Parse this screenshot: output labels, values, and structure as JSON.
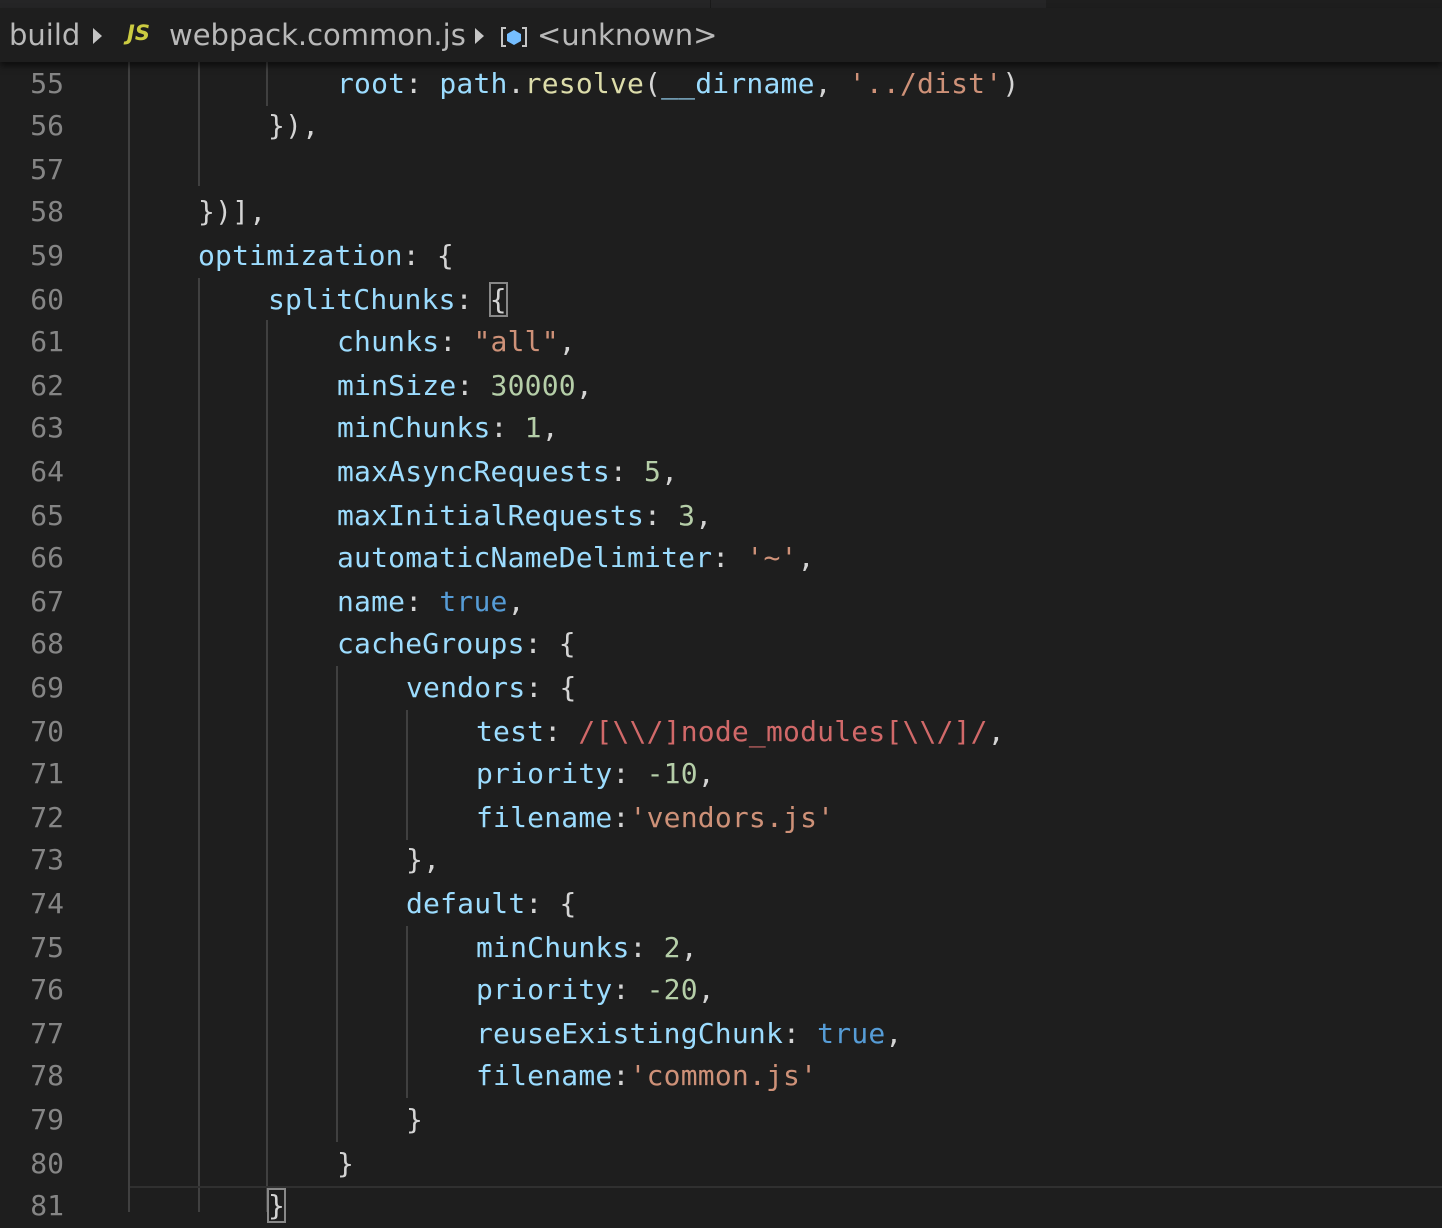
{
  "breadcrumbs": {
    "folder": "build",
    "file_badge": "JS",
    "file": "webpack.common.js",
    "symbol": "<unknown>"
  },
  "colors": {
    "background": "#1e1e1e",
    "line_number": "#858585",
    "property": "#9cdcfe",
    "string": "#ce9178",
    "number": "#b5cea8",
    "keyword": "#569cd6",
    "function": "#dcdcaa",
    "regex": "#d16969",
    "js_badge": "#cbcb41",
    "module_icon": "#75beff"
  },
  "icons": {
    "breadcrumb_separator": "chevron-right-icon",
    "file_type": "javascript-file-icon",
    "symbol": "module-symbol-icon"
  },
  "editor": {
    "lines": [
      {
        "n": "55",
        "code": "root: path.resolve(__dirname, '../dist')"
      },
      {
        "n": "56",
        "code": "}),"
      },
      {
        "n": "57",
        "code": ""
      },
      {
        "n": "58",
        "code": "})],"
      },
      {
        "n": "59",
        "code": "optimization: {"
      },
      {
        "n": "60",
        "code": "splitChunks: {"
      },
      {
        "n": "61",
        "code": "chunks: \"all\","
      },
      {
        "n": "62",
        "code": "minSize: 30000,"
      },
      {
        "n": "63",
        "code": "minChunks: 1,"
      },
      {
        "n": "64",
        "code": "maxAsyncRequests: 5,"
      },
      {
        "n": "65",
        "code": "maxInitialRequests: 3,"
      },
      {
        "n": "66",
        "code": "automaticNameDelimiter: '~',"
      },
      {
        "n": "67",
        "code": "name: true,"
      },
      {
        "n": "68",
        "code": "cacheGroups: {"
      },
      {
        "n": "69",
        "code": "vendors: {"
      },
      {
        "n": "70",
        "code": "test: /[\\\\/]node_modules[\\\\/]/,"
      },
      {
        "n": "71",
        "code": "priority: -10,"
      },
      {
        "n": "72",
        "code": "filename:'vendors.js'"
      },
      {
        "n": "73",
        "code": "},"
      },
      {
        "n": "74",
        "code": "default: {"
      },
      {
        "n": "75",
        "code": "minChunks: 2,"
      },
      {
        "n": "76",
        "code": "priority: -20,"
      },
      {
        "n": "77",
        "code": "reuseExistingChunk: true,"
      },
      {
        "n": "78",
        "code": "filename:'common.js'"
      },
      {
        "n": "79",
        "code": "}"
      },
      {
        "n": "80",
        "code": "}"
      },
      {
        "n": "81",
        "code": "}"
      }
    ]
  }
}
